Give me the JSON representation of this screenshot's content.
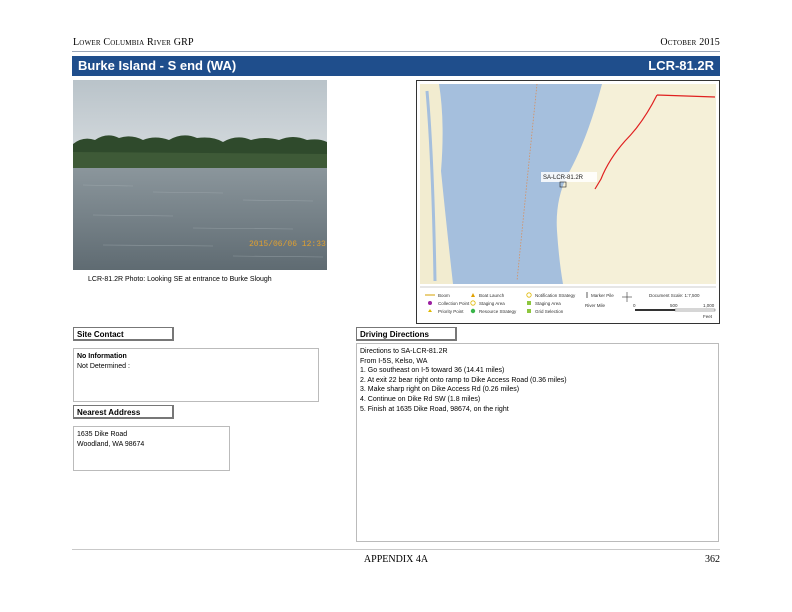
{
  "header": {
    "organization": "Lower Columbia River GRP",
    "date": "October 2015"
  },
  "title": {
    "site_name": "Burke Island - S end (WA)",
    "site_code": "LCR-81.2R"
  },
  "photo": {
    "caption": "LCR-81.2R Photo: Looking SE at entrance to Burke Slough",
    "stamp": "2015/06/06 12:33"
  },
  "map": {
    "label": "SA-LCR-81.2R",
    "legend": {
      "items": [
        {
          "label": "Boom",
          "icon": "boom-line-icon",
          "color": "#d4a000"
        },
        {
          "label": "Collection Point",
          "icon": "collection-point-icon",
          "color": "#9b1fa0"
        },
        {
          "label": "Priority Point",
          "icon": "priority-point-icon",
          "color": "#e0b800"
        },
        {
          "label": "Boat Launch",
          "icon": "boat-launch-icon",
          "color": "#e0a000"
        },
        {
          "label": "Staging Area",
          "icon": "staging-area-icon",
          "color": "#e0b800"
        },
        {
          "label": "Resource Strategy",
          "icon": "resource-strategy-icon",
          "color": "#3ab54a"
        },
        {
          "label": "Notification Strategy",
          "icon": "notification-strategy-icon",
          "color": "#e0b800"
        },
        {
          "label": "Staging Area",
          "icon": "staging-square-icon",
          "color": "#8dc63f"
        },
        {
          "label": "Grid Selection",
          "icon": "grid-selection-icon",
          "color": "#8dc63f"
        },
        {
          "label": "Marker Pile",
          "icon": "marker-pile-icon",
          "color": "#333333"
        },
        {
          "label": "River Mile",
          "icon": "river-mile-icon",
          "color": "#333333"
        }
      ],
      "scale_note": "Document Scale: 1:7,500",
      "scale_ticks": [
        "0",
        "500",
        "1,000"
      ],
      "units": "Feet"
    },
    "colors": {
      "water": "#a5bfdd",
      "land": "#f5f0d8",
      "route": "#e02020"
    }
  },
  "site_contact": {
    "heading": "Site Contact",
    "name": "No Information",
    "detail": "Not Determined :"
  },
  "nearest_address": {
    "heading": "Nearest Address",
    "line1": "1635 Dike Road",
    "line2": "Woodland, WA  98674"
  },
  "driving_directions": {
    "heading": "Driving Directions",
    "lines": [
      "Directions to SA-LCR-81.2R",
      "From I-5S, Kelso, WA",
      "1. Go southeast on I-5 toward 36 (14.41 miles)",
      "2. At exit 22 bear right onto ramp to Dike Access Road (0.36 miles)",
      "3. Make sharp right on Dike Access Rd (0.26 miles)",
      "4. Continue on Dike Rd SW (1.8 miles)",
      "5. Finish at 1635 Dike Road, 98674, on the right"
    ]
  },
  "footer": {
    "appendix": "APPENDIX 4A",
    "page_number": "362"
  }
}
